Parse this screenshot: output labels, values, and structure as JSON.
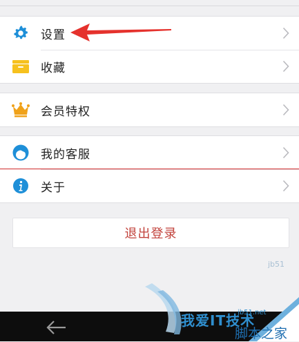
{
  "menu": {
    "items": [
      {
        "label": "设置",
        "icon": "gear-icon"
      },
      {
        "label": "收藏",
        "icon": "folder-icon"
      },
      {
        "label": "会员特权",
        "icon": "crown-icon"
      },
      {
        "label": "我的客服",
        "icon": "support-avatar-icon"
      },
      {
        "label": "关于",
        "icon": "info-icon"
      }
    ]
  },
  "logout": {
    "label": "退出登录"
  },
  "watermark": {
    "brand_text": "我爱IT技术",
    "site": "jb51.net",
    "site_name": "脚本之家",
    "side_text": "jb51"
  },
  "colors": {
    "accent_blue": "#1e8fd8",
    "folder_yellow": "#f6c11e",
    "crown_orange": "#f0a21a",
    "logout_red": "#c2423b",
    "annotation_red": "#e5322d",
    "background": "#f0f0f2"
  }
}
